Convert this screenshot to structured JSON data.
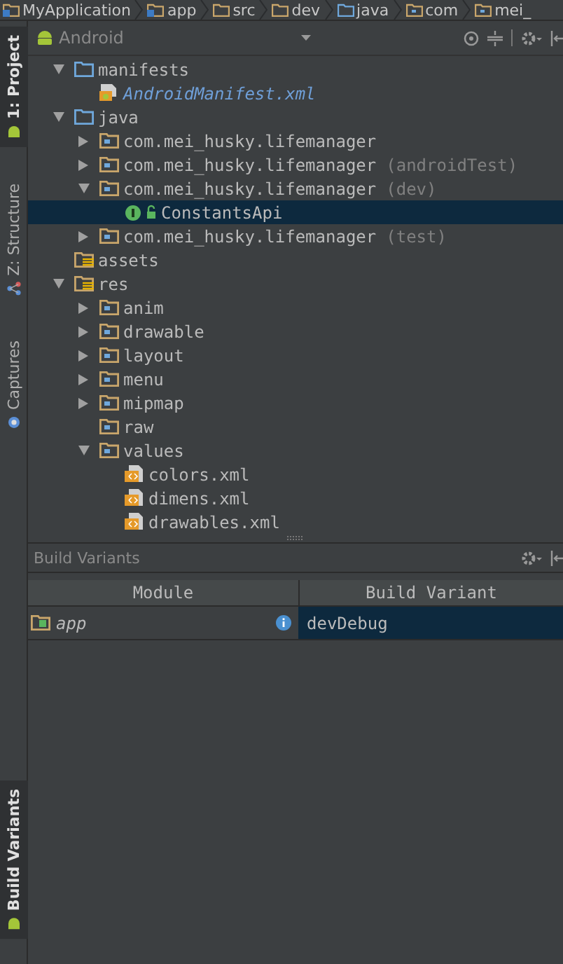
{
  "breadcrumbs": [
    {
      "label": "MyApplication",
      "kind": "project"
    },
    {
      "label": "app",
      "kind": "module"
    },
    {
      "label": "src",
      "kind": "folder"
    },
    {
      "label": "dev",
      "kind": "folder"
    },
    {
      "label": "java",
      "kind": "source"
    },
    {
      "label": "com",
      "kind": "package"
    },
    {
      "label": "mei_",
      "kind": "package"
    }
  ],
  "side_tabs": [
    {
      "label": "1: Project",
      "kind": "android",
      "selected": true
    },
    {
      "label": "Z: Structure",
      "kind": "structure",
      "selected": false
    },
    {
      "label": "Captures",
      "kind": "captures",
      "selected": false
    }
  ],
  "bottom_side_tabs": [
    {
      "label": "Build Variants",
      "kind": "android",
      "selected": true
    }
  ],
  "project_panel": {
    "view": "Android",
    "tree": [
      {
        "label": "manifests",
        "kind": "source_root",
        "expanded": true,
        "selected": false,
        "children": [
          {
            "label": "AndroidManifest.xml",
            "kind": "manifest",
            "selected": false
          }
        ]
      },
      {
        "label": "java",
        "kind": "source_root",
        "expanded": true,
        "selected": false,
        "children": [
          {
            "label": "com.mei_husky.lifemanager",
            "kind": "package",
            "expanded": false,
            "selected": false
          },
          {
            "label": "com.mei_husky.lifemanager",
            "note": "(androidTest)",
            "kind": "package",
            "expanded": false,
            "selected": false
          },
          {
            "label": "com.mei_husky.lifemanager",
            "note": "(dev)",
            "kind": "package",
            "expanded": true,
            "selected": false,
            "children": [
              {
                "label": "ConstantsApi",
                "kind": "interface",
                "selected": true
              }
            ]
          },
          {
            "label": "com.mei_husky.lifemanager",
            "note": "(test)",
            "kind": "package",
            "expanded": false,
            "selected": false
          }
        ]
      },
      {
        "label": "assets",
        "kind": "assets_folder",
        "selected": false
      },
      {
        "label": "res",
        "kind": "res_folder",
        "expanded": true,
        "selected": false,
        "children": [
          {
            "label": "anim",
            "kind": "package",
            "expanded": false,
            "selected": false
          },
          {
            "label": "drawable",
            "kind": "package",
            "expanded": false,
            "selected": false
          },
          {
            "label": "layout",
            "kind": "package",
            "expanded": false,
            "selected": false
          },
          {
            "label": "menu",
            "kind": "package",
            "expanded": false,
            "selected": false
          },
          {
            "label": "mipmap",
            "kind": "package",
            "expanded": false,
            "selected": false
          },
          {
            "label": "raw",
            "kind": "package",
            "selected": false
          },
          {
            "label": "values",
            "kind": "package",
            "expanded": true,
            "selected": false,
            "children": [
              {
                "label": "colors.xml",
                "kind": "xml",
                "selected": false
              },
              {
                "label": "dimens.xml",
                "kind": "xml",
                "selected": false
              },
              {
                "label": "drawables.xml",
                "kind": "xml",
                "selected": false
              }
            ]
          }
        ]
      }
    ]
  },
  "build_variants": {
    "title": "Build Variants",
    "columns": [
      "Module",
      "Build Variant"
    ],
    "rows": [
      {
        "module": "app",
        "variant": "devDebug",
        "selected": true
      }
    ]
  }
}
